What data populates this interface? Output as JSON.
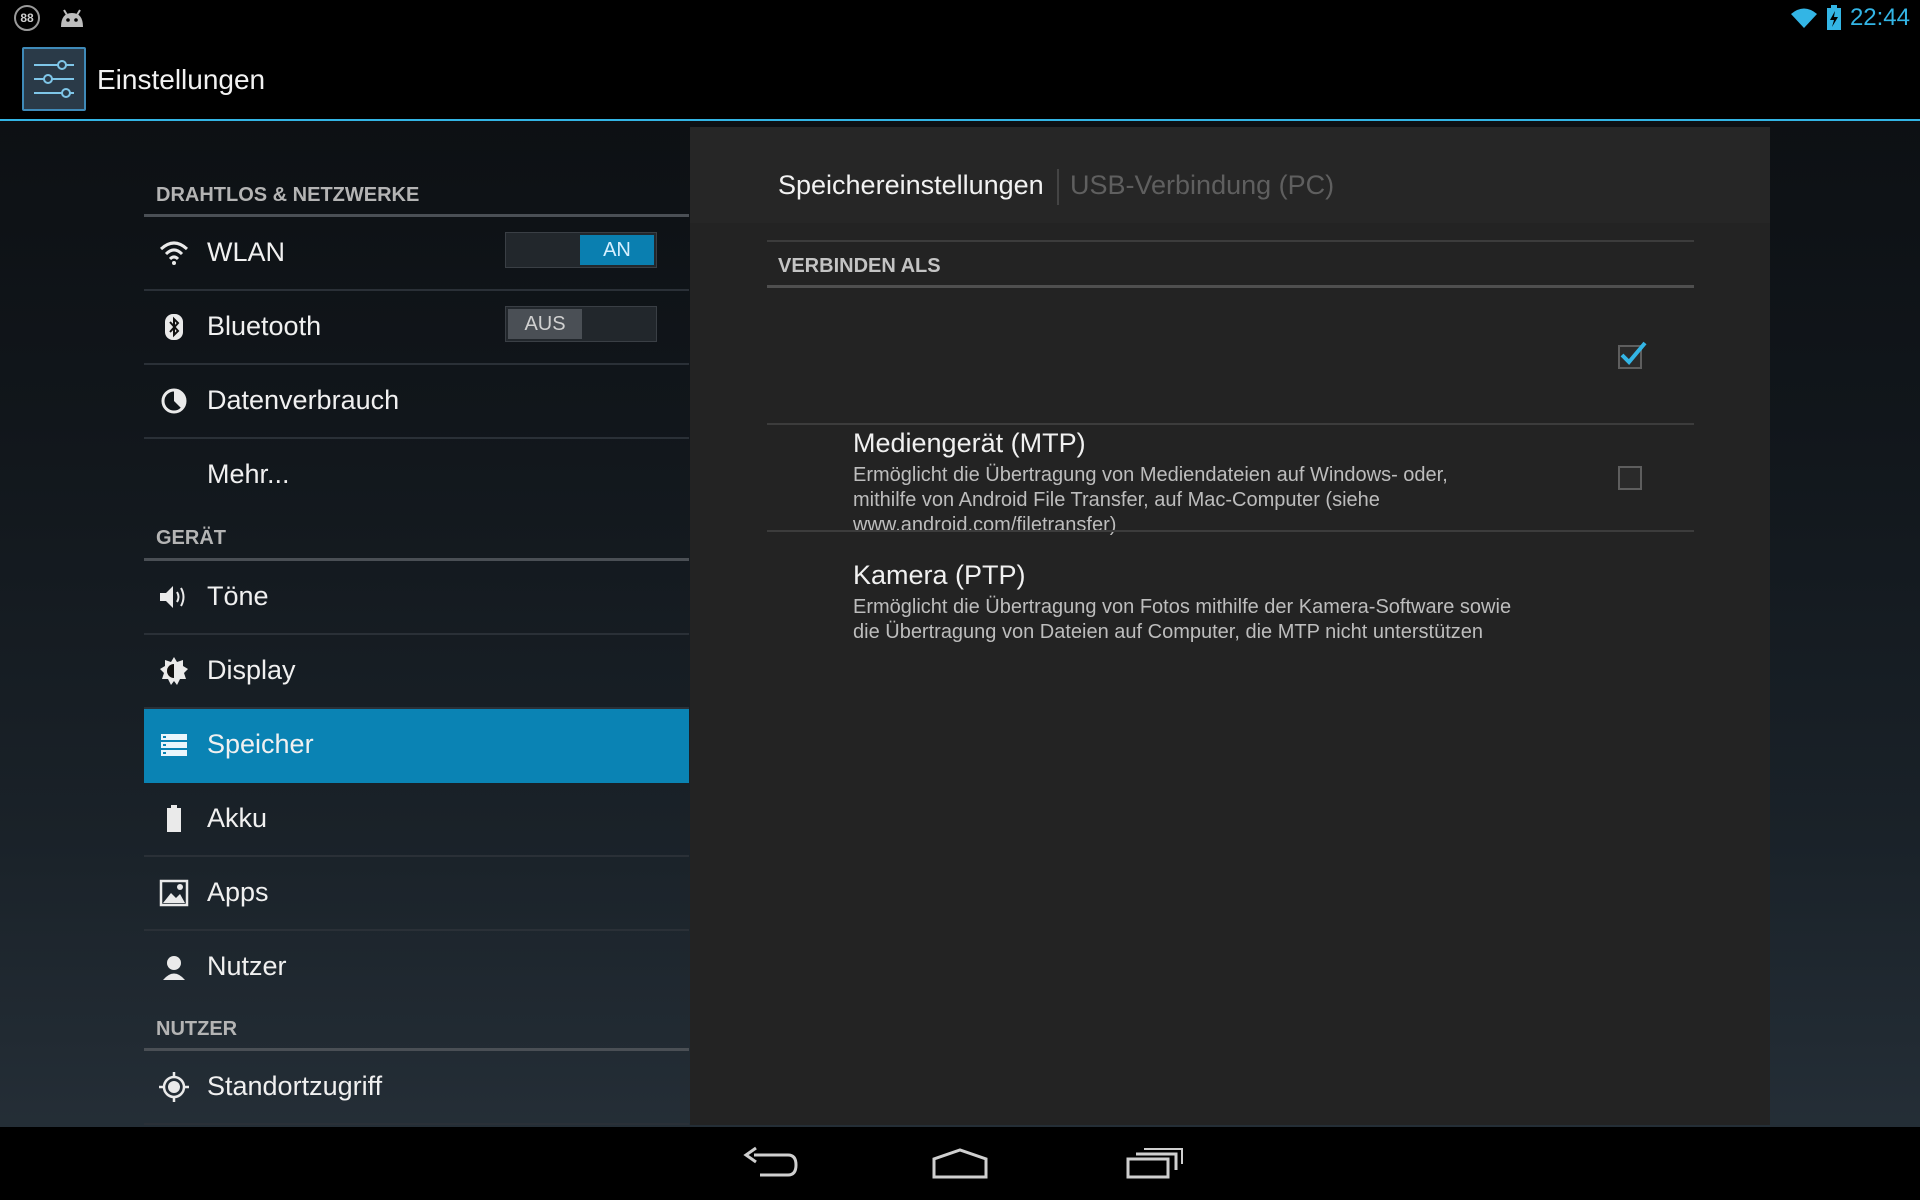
{
  "status_bar": {
    "notification_badge": "88",
    "notification_icons": [
      "badge-icon",
      "android-icon"
    ],
    "status_icons": [
      "wifi-icon",
      "battery-charging-icon"
    ],
    "time": "22:44",
    "accent_color": "#33b5e5"
  },
  "action_bar": {
    "title": "Einstellungen",
    "icon": "settings-sliders-icon"
  },
  "sidebar": {
    "sections": [
      {
        "header": "DRAHTLOS & NETZWERKE"
      },
      {
        "header": "GERÄT"
      },
      {
        "header": "NUTZER"
      }
    ],
    "items": [
      {
        "label": "WLAN",
        "icon": "wifi-icon",
        "toggle": "AN"
      },
      {
        "label": "Bluetooth",
        "icon": "bluetooth-icon",
        "toggle": "AUS"
      },
      {
        "label": "Datenverbrauch",
        "icon": "data-usage-icon"
      },
      {
        "label": "Mehr..."
      },
      {
        "label": "Töne",
        "icon": "speaker-icon"
      },
      {
        "label": "Display",
        "icon": "brightness-icon"
      },
      {
        "label": "Speicher",
        "icon": "storage-icon",
        "selected": true
      },
      {
        "label": "Akku",
        "icon": "battery-icon"
      },
      {
        "label": "Apps",
        "icon": "apps-icon"
      },
      {
        "label": "Nutzer",
        "icon": "user-icon"
      },
      {
        "label": "Standortzugriff",
        "icon": "location-icon"
      }
    ],
    "selected_color": "#0a83b4"
  },
  "main": {
    "tabs": [
      {
        "label": "Speichereinstellungen",
        "active": true
      },
      {
        "label": "USB-Verbindung (PC)",
        "active": false
      }
    ],
    "category": "VERBINDEN ALS",
    "preferences": [
      {
        "title": "Mediengerät (MTP)",
        "summary_lines": [
          "Ermöglicht die Übertragung von Mediendateien auf Windows- oder,",
          "mithilfe von Android File Transfer, auf Mac-Computer (siehe",
          "www.android.com/filetransfer)"
        ],
        "checked": true
      },
      {
        "title": "Kamera (PTP)",
        "summary_lines": [
          "Ermöglicht die Übertragung von Fotos mithilfe der Kamera-Software sowie",
          "die Übertragung von Dateien auf Computer, die MTP nicht unterstützen"
        ],
        "checked": false
      }
    ]
  },
  "nav_bar": {
    "buttons": [
      "back-icon",
      "home-icon",
      "recents-icon"
    ]
  }
}
